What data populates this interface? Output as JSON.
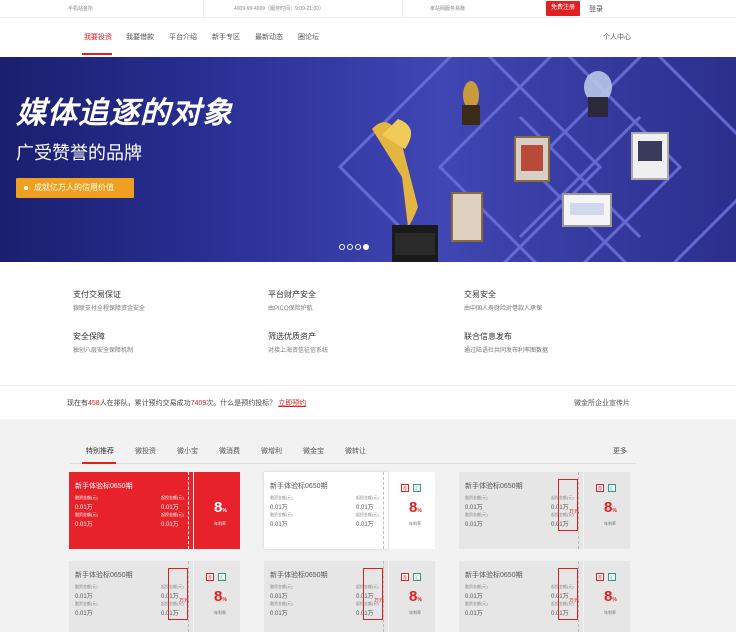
{
  "topbar": {
    "mobile": "手机站金所",
    "hotline": "4009-99-4009（服务时间：9:00-21:00）",
    "slogan": "家站网服务易赚",
    "register": "免费注册",
    "login": "登录"
  },
  "nav": {
    "items": [
      "我要投资",
      "我要借款",
      "平台介绍",
      "新手专区",
      "最新动态",
      "圈论坛"
    ],
    "user_center": "个人中心"
  },
  "banner": {
    "headline": "媒体追逐的对象",
    "subline": "广受赞誉的品牌",
    "pill": "成就亿万人的信用价值"
  },
  "features": [
    {
      "title": "支付交易保证",
      "desc": "银联支付全程保障资金安全"
    },
    {
      "title": "平台财产安全",
      "desc": "由PICO保险护航"
    },
    {
      "title": "交易安全",
      "desc": "由中国人寿财险对借款人承保"
    },
    {
      "title": "安全保障",
      "desc": "独创八层安全保障机制"
    },
    {
      "title": "筛选优质资产",
      "desc": "对接上海资信征信系统"
    },
    {
      "title": "联合信息发布",
      "desc": "通过陆语社共同发布利率图数据"
    }
  ],
  "queue": {
    "prefix": "现在有",
    "count": "458",
    "mid": "人在排队，累计预约交易成功",
    "success": "7409",
    "suffix": "次。什么是预约投标？",
    "link": "立即预约",
    "promo": "微金所企业宣传片"
  },
  "products": {
    "tabs": [
      "特别推荐",
      "微投资",
      "微小宝",
      "微消费",
      "微增利",
      "微金宝",
      "微转让"
    ],
    "more": "更多",
    "card": {
      "title": "新手体验标0650期",
      "label_a": "融资金额(元)",
      "label_b": "起投金额(元)",
      "value": "0.01万",
      "rate": "8",
      "rate_unit": "%",
      "rate_label": "年利率",
      "tag_red": "荐",
      "tag_green": "汇",
      "yuan": "万元"
    }
  },
  "colors": {
    "accent": "#e02020",
    "banner": "#2a3095",
    "pill": "#f0a020"
  }
}
